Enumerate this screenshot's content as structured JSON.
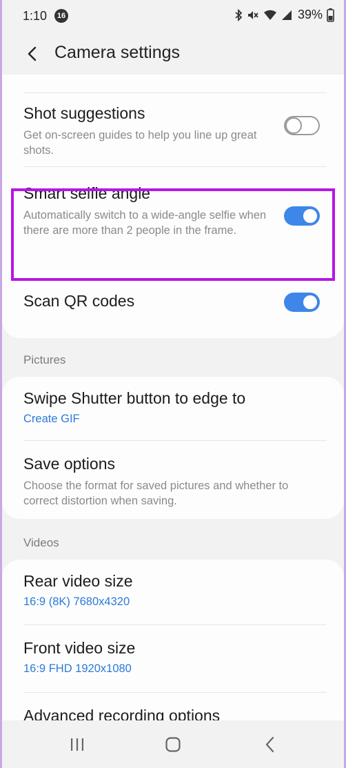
{
  "status_bar": {
    "time": "1:10",
    "notification_count": "16",
    "battery_percent": "39%"
  },
  "header": {
    "title": "Camera settings"
  },
  "settings": {
    "shot_suggestions": {
      "title": "Shot suggestions",
      "description": "Get on-screen guides to help you line up great shots.",
      "enabled": false
    },
    "smart_selfie_angle": {
      "title": "Smart selfie angle",
      "description": "Automatically switch to a wide-angle selfie when there are more than 2 people in the frame.",
      "enabled": true
    },
    "scan_qr_codes": {
      "title": "Scan QR codes",
      "enabled": true
    }
  },
  "pictures": {
    "section_label": "Pictures",
    "swipe_shutter": {
      "title": "Swipe Shutter button to edge to",
      "value": "Create GIF"
    },
    "save_options": {
      "title": "Save options",
      "description": "Choose the format for saved pictures and whether to correct distortion when saving."
    }
  },
  "videos": {
    "section_label": "Videos",
    "rear_video_size": {
      "title": "Rear video size",
      "value": "16:9 (8K) 7680x4320"
    },
    "front_video_size": {
      "title": "Front video size",
      "value": "16:9 FHD 1920x1080"
    },
    "advanced_recording": {
      "title": "Advanced recording options"
    }
  },
  "colors": {
    "accent": "#3e86e8",
    "link_text": "#2a7ad8",
    "highlight_border": "#b517e2",
    "background": "#f2f2f2",
    "card": "#fdfdfd"
  },
  "icons": {
    "back": "arrow-left-icon",
    "recent_apps": "recent-apps-icon",
    "home": "home-icon",
    "nav_back": "chevron-left-icon"
  }
}
